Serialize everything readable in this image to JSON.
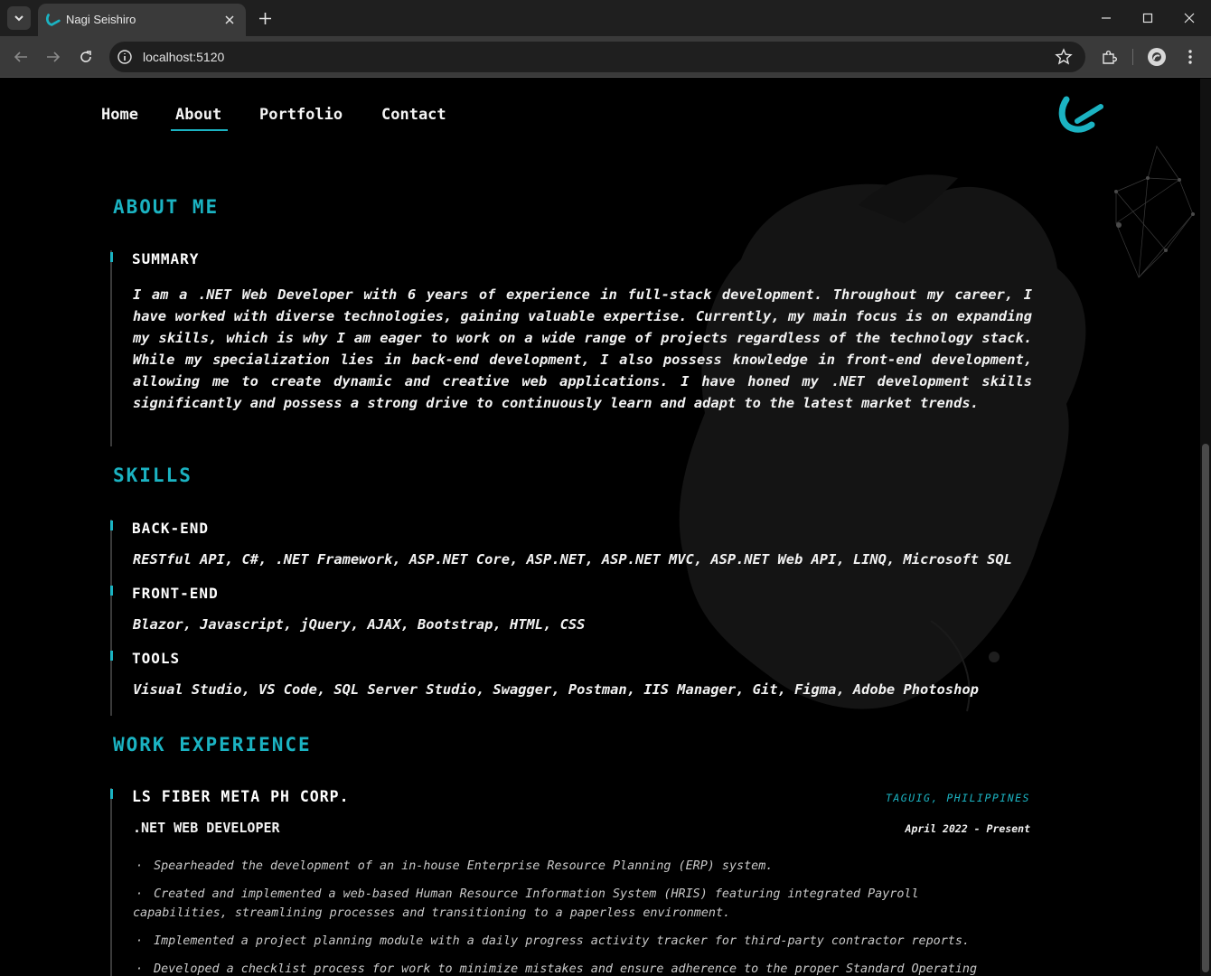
{
  "browser": {
    "tab_title": "Nagi Seishiro",
    "url": "localhost:5120"
  },
  "nav": {
    "items": [
      "Home",
      "About",
      "Portfolio",
      "Contact"
    ],
    "active": "About"
  },
  "about": {
    "title": "ABOUT ME",
    "summary_heading": "SUMMARY",
    "summary_text": "I am a .NET Web Developer with 6 years of experience in full-stack development. Throughout my career, I have worked with diverse technologies, gaining valuable expertise. Currently, my main focus is on expanding my skills, which is why I am eager to work on a wide range of projects regardless of the technology stack. While my specialization lies in back-end development, I also possess knowledge in front-end development, allowing me to create dynamic and creative web applications. I have honed my .NET development skills significantly and possess a strong drive to continuously learn and adapt to the latest market trends."
  },
  "skills": {
    "title": "SKILLS",
    "groups": [
      {
        "heading": "BACK-END",
        "items": "RESTful API, C#, .NET Framework, ASP.NET Core, ASP.NET, ASP.NET MVC, ASP.NET Web API, LINQ, Microsoft SQL"
      },
      {
        "heading": "FRONT-END",
        "items": "Blazor, Javascript, jQuery, AJAX, Bootstrap, HTML, CSS"
      },
      {
        "heading": "TOOLS",
        "items": "Visual Studio, VS Code, SQL Server Studio, Swagger, Postman, IIS Manager, Git, Figma, Adobe Photoshop"
      }
    ]
  },
  "experience": {
    "title": "WORK EXPERIENCE",
    "jobs": [
      {
        "company": "LS FIBER META PH CORP.",
        "location": "TAGUIG, PHILIPPINES",
        "role": ".NET WEB DEVELOPER",
        "date": "April 2022 - Present",
        "bullets": [
          "Spearheaded the development of an in-house Enterprise Resource Planning (ERP) system.",
          "Created and implemented a web-based Human Resource Information System (HRIS) featuring integrated Payroll capabilities, streamlining processes and transitioning to a paperless environment.",
          "Implemented a project planning module with a daily progress activity tracker for third-party contractor reports.",
          "Developed a checklist process for work to minimize mistakes and ensure adherence to the proper Standard Operating"
        ]
      }
    ]
  },
  "colors": {
    "accent": "#1bb3c2",
    "background": "#000000",
    "text": "#f2f2f2"
  }
}
